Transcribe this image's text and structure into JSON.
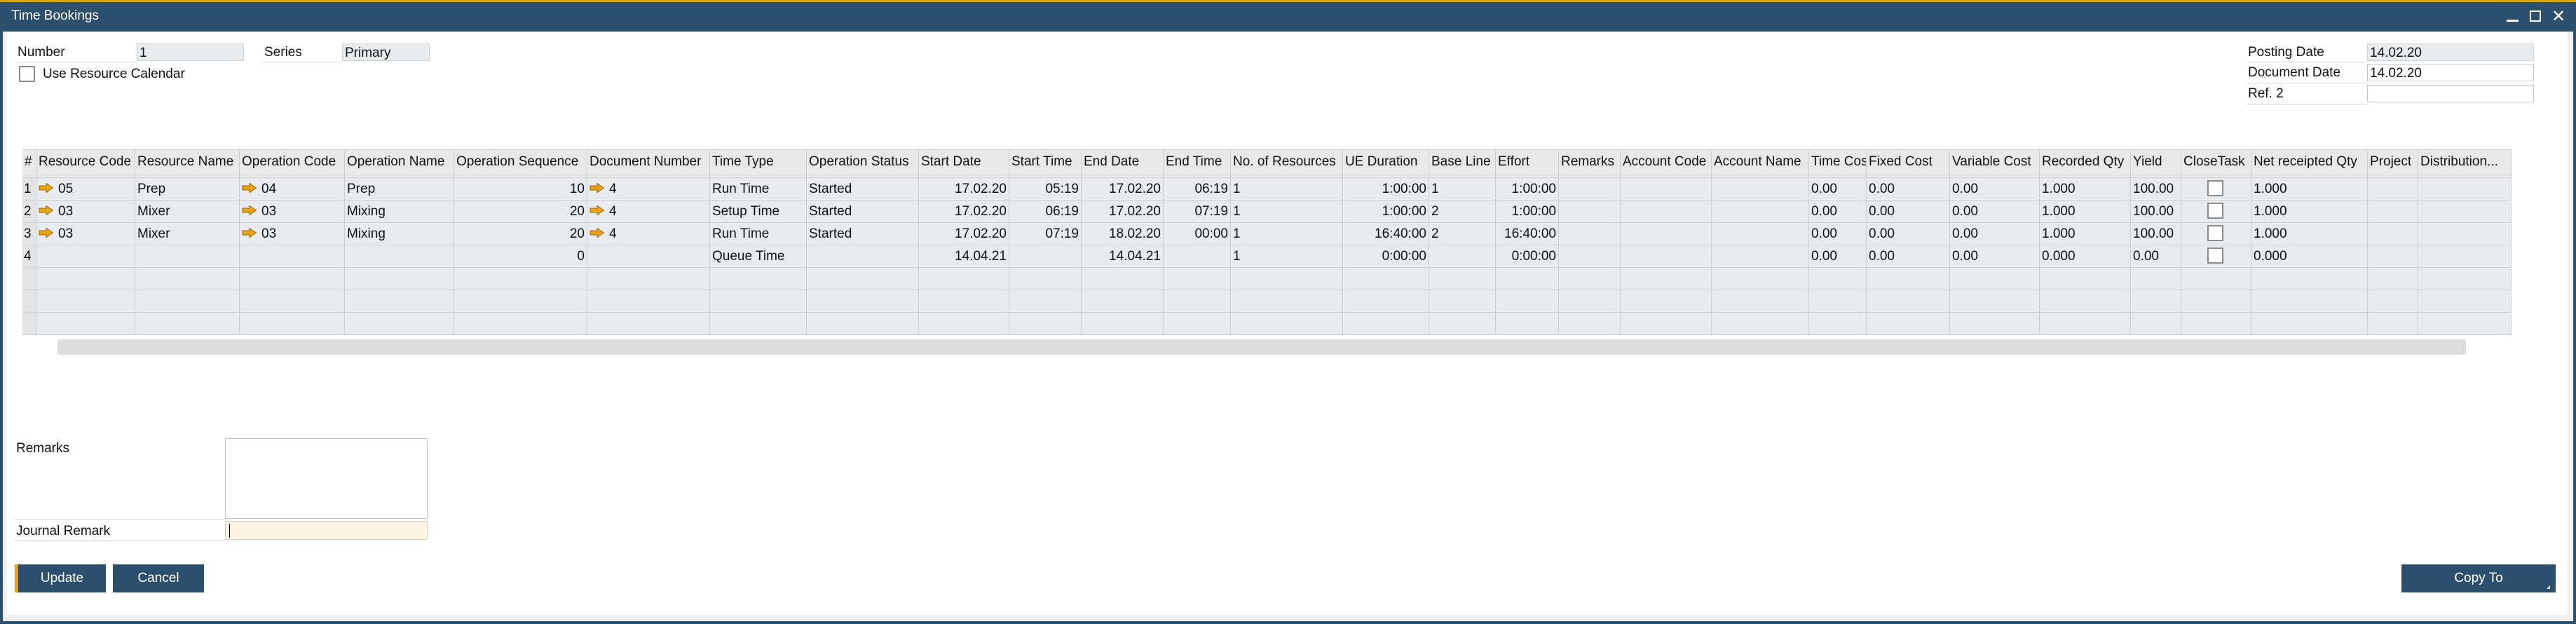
{
  "window": {
    "title": "Time Bookings",
    "controls": {
      "minimize": "minimize",
      "maximize": "maximize",
      "close": "✕"
    }
  },
  "header": {
    "number_label": "Number",
    "number_value": "1",
    "series_label": "Series",
    "series_value": "Primary",
    "use_resource_calendar_label": "Use Resource Calendar",
    "use_resource_calendar_checked": false,
    "posting_date_label": "Posting Date",
    "posting_date_value": "14.02.20",
    "document_date_label": "Document Date",
    "document_date_value": "14.02.20",
    "ref2_label": "Ref. 2",
    "ref2_value": ""
  },
  "grid": {
    "columns": [
      {
        "key": "num",
        "label": "#"
      },
      {
        "key": "resource_code",
        "label": "Resource Code"
      },
      {
        "key": "resource_name",
        "label": "Resource Name"
      },
      {
        "key": "operation_code",
        "label": "Operation Code"
      },
      {
        "key": "operation_name",
        "label": "Operation Name"
      },
      {
        "key": "operation_sequence",
        "label": "Operation Sequence"
      },
      {
        "key": "document_number",
        "label": "Document Number"
      },
      {
        "key": "time_type",
        "label": "Time Type"
      },
      {
        "key": "operation_status",
        "label": "Operation Status"
      },
      {
        "key": "start_date",
        "label": "Start Date"
      },
      {
        "key": "start_time",
        "label": "Start Time"
      },
      {
        "key": "end_date",
        "label": "End Date"
      },
      {
        "key": "end_time",
        "label": "End Time"
      },
      {
        "key": "no_of_resources",
        "label": "No. of Resources"
      },
      {
        "key": "ue_duration",
        "label": "UE Duration"
      },
      {
        "key": "base_line",
        "label": "Base Line"
      },
      {
        "key": "effort",
        "label": "Effort"
      },
      {
        "key": "remarks",
        "label": "Remarks"
      },
      {
        "key": "account_code",
        "label": "Account Code"
      },
      {
        "key": "account_name",
        "label": "Account Name"
      },
      {
        "key": "time_cost",
        "label": "Time Cost"
      },
      {
        "key": "fixed_cost",
        "label": "Fixed Cost"
      },
      {
        "key": "variable_cost",
        "label": "Variable Cost"
      },
      {
        "key": "recorded_qty",
        "label": "Recorded Qty"
      },
      {
        "key": "yield",
        "label": "Yield"
      },
      {
        "key": "close_task",
        "label": "CloseTask"
      },
      {
        "key": "net_receipted_qty",
        "label": "Net receipted Qty"
      },
      {
        "key": "project",
        "label": "Project"
      },
      {
        "key": "distribution",
        "label": "Distribution..."
      }
    ],
    "rows": [
      {
        "num": "1",
        "resource_code": "05",
        "resource_name": "Prep",
        "operation_code": "04",
        "operation_name": "Prep",
        "operation_sequence": "10",
        "document_number": "4",
        "time_type": "Run Time",
        "operation_status": "Started",
        "start_date": "17.02.20",
        "start_time": "05:19",
        "end_date": "17.02.20",
        "end_time": "06:19",
        "no_of_resources": "1",
        "ue_duration": "1:00:00",
        "base_line": "1",
        "effort": "1:00:00",
        "remarks": "",
        "account_code": "",
        "account_name": "",
        "time_cost": "0.00",
        "fixed_cost": "0.00",
        "variable_cost": "0.00",
        "recorded_qty": "1.000",
        "yield": "100.00",
        "close_task": false,
        "net_receipted_qty": "1.000",
        "project": "",
        "distribution": "",
        "links": [
          "resource_code",
          "operation_code",
          "document_number"
        ]
      },
      {
        "num": "2",
        "resource_code": "03",
        "resource_name": "Mixer",
        "operation_code": "03",
        "operation_name": "Mixing",
        "operation_sequence": "20",
        "document_number": "4",
        "time_type": "Setup Time",
        "operation_status": "Started",
        "start_date": "17.02.20",
        "start_time": "06:19",
        "end_date": "17.02.20",
        "end_time": "07:19",
        "no_of_resources": "1",
        "ue_duration": "1:00:00",
        "base_line": "2",
        "effort": "1:00:00",
        "remarks": "",
        "account_code": "",
        "account_name": "",
        "time_cost": "0.00",
        "fixed_cost": "0.00",
        "variable_cost": "0.00",
        "recorded_qty": "1.000",
        "yield": "100.00",
        "close_task": false,
        "net_receipted_qty": "1.000",
        "project": "",
        "distribution": "",
        "links": [
          "resource_code",
          "operation_code",
          "document_number"
        ]
      },
      {
        "num": "3",
        "resource_code": "03",
        "resource_name": "Mixer",
        "operation_code": "03",
        "operation_name": "Mixing",
        "operation_sequence": "20",
        "document_number": "4",
        "time_type": "Run Time",
        "operation_status": "Started",
        "start_date": "17.02.20",
        "start_time": "07:19",
        "end_date": "18.02.20",
        "end_time": "00:00",
        "no_of_resources": "1",
        "ue_duration": "16:40:00",
        "base_line": "2",
        "effort": "16:40:00",
        "remarks": "",
        "account_code": "",
        "account_name": "",
        "time_cost": "0.00",
        "fixed_cost": "0.00",
        "variable_cost": "0.00",
        "recorded_qty": "1.000",
        "yield": "100.00",
        "close_task": false,
        "net_receipted_qty": "1.000",
        "project": "",
        "distribution": "",
        "links": [
          "resource_code",
          "operation_code",
          "document_number"
        ]
      },
      {
        "num": "4",
        "resource_code": "",
        "resource_name": "",
        "operation_code": "",
        "operation_name": "",
        "operation_sequence": "0",
        "document_number": "",
        "time_type": "Queue Time",
        "operation_status": "",
        "start_date": "14.04.21",
        "start_time": "",
        "end_date": "14.04.21",
        "end_time": "",
        "no_of_resources": "1",
        "ue_duration": "0:00:00",
        "base_line": "",
        "effort": "0:00:00",
        "remarks": "",
        "account_code": "",
        "account_name": "",
        "time_cost": "0.00",
        "fixed_cost": "0.00",
        "variable_cost": "0.00",
        "recorded_qty": "0.000",
        "yield": "0.00",
        "close_task": false,
        "net_receipted_qty": "0.000",
        "project": "",
        "distribution": "",
        "links": []
      }
    ],
    "empty_rows": 3
  },
  "footer": {
    "remarks_label": "Remarks",
    "remarks_value": "",
    "journal_remark_label": "Journal Remark",
    "journal_remark_value": "",
    "update_label": "Update",
    "cancel_label": "Cancel",
    "copy_to_label": "Copy To"
  },
  "colors": {
    "titlebar": "#2c4f6c",
    "accent": "#e0a11b",
    "link_arrow": "#e8a317"
  }
}
